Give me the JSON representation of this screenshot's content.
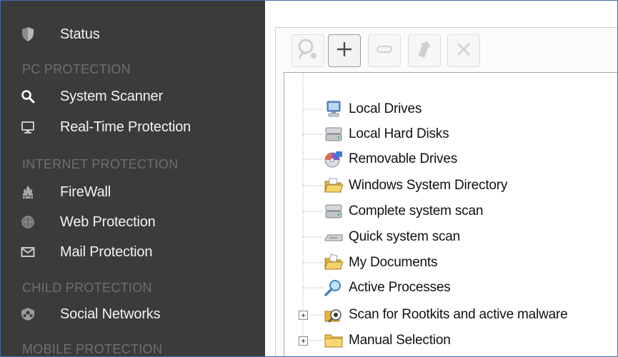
{
  "sidebar": {
    "status_label": "Status",
    "sections": {
      "pc_protection": "PC PROTECTION",
      "internet_protection": "INTERNET PROTECTION",
      "child_protection": "CHILD PROTECTION",
      "mobile_protection": "MOBILE PROTECTION"
    },
    "items": {
      "system_scanner": "System Scanner",
      "realtime_protection": "Real-Time Protection",
      "firewall": "FireWall",
      "web_protection": "Web Protection",
      "mail_protection": "Mail Protection",
      "social_networks": "Social Networks"
    },
    "icons": {
      "status": "shield-icon",
      "system_scanner": "search-icon",
      "realtime_protection": "monitor-icon",
      "firewall": "firewall-icon",
      "web_protection": "globe-icon",
      "mail_protection": "envelope-icon",
      "social_networks": "social-networks-icon"
    },
    "colors": {
      "background": "#3b3b3b",
      "label": "#f2f2f2",
      "section": "#6f6f6f"
    }
  },
  "toolbar": {
    "buttons": [
      {
        "name": "new-profile-button",
        "icon": "user-add-icon",
        "enabled": false
      },
      {
        "name": "add-button",
        "icon": "plus-icon",
        "enabled": true
      },
      {
        "name": "rename-button",
        "icon": "rename-icon",
        "enabled": false
      },
      {
        "name": "shortcut-button",
        "icon": "shortcut-arrow-icon",
        "enabled": false
      },
      {
        "name": "delete-button",
        "icon": "close-icon",
        "enabled": false
      }
    ]
  },
  "profiles": {
    "items": [
      {
        "label": "Local Drives",
        "icon": "monitor-icon",
        "expandable": false
      },
      {
        "label": "Local Hard Disks",
        "icon": "hard-disk-icon",
        "expandable": false
      },
      {
        "label": "Removable Drives",
        "icon": "removable-drive-icon",
        "expandable": false
      },
      {
        "label": "Windows System Directory",
        "icon": "folder-open-icon",
        "expandable": false
      },
      {
        "label": "Complete system scan",
        "icon": "hard-disk-icon",
        "expandable": false
      },
      {
        "label": "Quick system scan",
        "icon": "drive-icon",
        "expandable": false
      },
      {
        "label": "My Documents",
        "icon": "folder-open-icon",
        "expandable": false
      },
      {
        "label": "Active Processes",
        "icon": "magnifier-icon",
        "expandable": false
      },
      {
        "label": "Scan for Rootkits and active malware",
        "icon": "rootkit-scan-icon",
        "expandable": true,
        "expander": "+"
      },
      {
        "label": "Manual Selection",
        "icon": "folder-icon",
        "expandable": true,
        "expander": "+"
      }
    ]
  }
}
